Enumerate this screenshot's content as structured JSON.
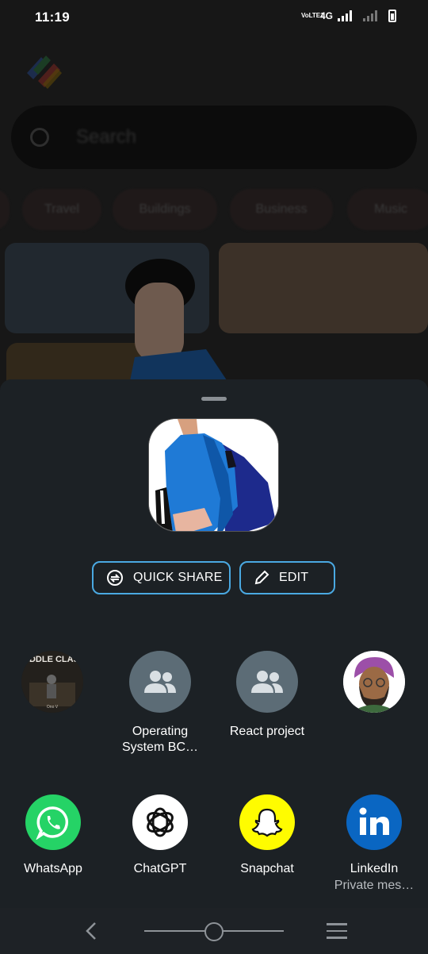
{
  "status_bar": {
    "time": "11:19",
    "volte": "VoLTE1",
    "network": "4G"
  },
  "background_app": {
    "search_placeholder": "Search",
    "chips": [
      "",
      "Travel",
      "Buildings",
      "Business",
      "Music"
    ]
  },
  "share_sheet": {
    "buttons": {
      "quick_share": "QUICK SHARE",
      "edit": "EDIT"
    },
    "contacts": [
      {
        "name": "",
        "avatar_text": "MIDDLE CLASS",
        "avatar_sub": "Ono V"
      },
      {
        "name": "Operating System BC…",
        "icon": "group-icon"
      },
      {
        "name": "React project",
        "icon": "group-icon"
      },
      {
        "name": "",
        "icon": "turban-avatar"
      }
    ],
    "apps": [
      {
        "name": "WhatsApp",
        "sub": "",
        "color": "#25D366"
      },
      {
        "name": "ChatGPT",
        "sub": "",
        "color": "#ffffff"
      },
      {
        "name": "Snapchat",
        "sub": "",
        "color": "#FFFC00"
      },
      {
        "name": "LinkedIn",
        "sub": "Private mes…",
        "color": "#0A66C2"
      }
    ]
  },
  "colors": {
    "sheet_bg": "#1c2125",
    "accent_border": "#4aa9e2",
    "nav_bg": "#1e2226"
  }
}
